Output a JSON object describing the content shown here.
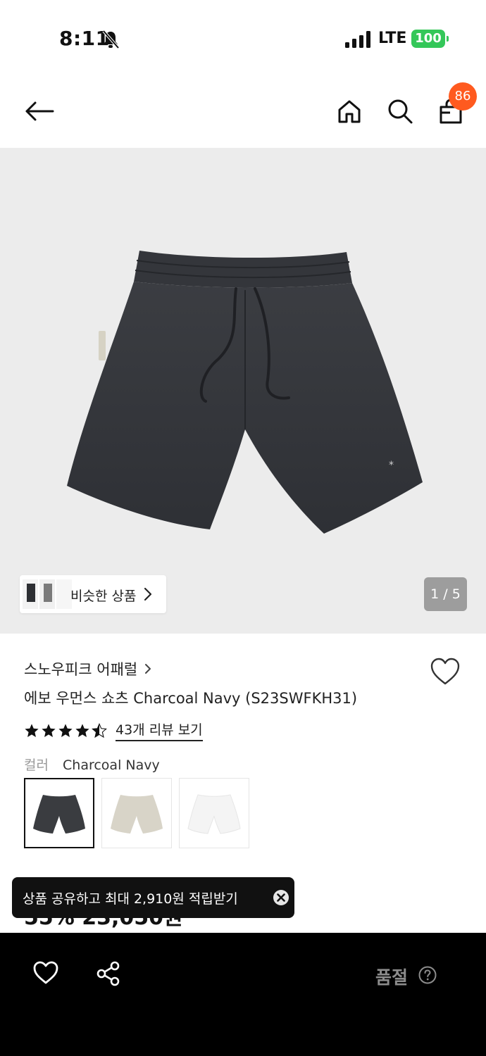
{
  "status_bar": {
    "time": "8:11",
    "network": "LTE",
    "battery": "100"
  },
  "header": {
    "cart_count": "86"
  },
  "gallery": {
    "similar_label": "비슷한 상품",
    "page_counter": "1 / 5"
  },
  "product": {
    "brand": "스노우피크 어패럴",
    "title": "에보 우먼스 쇼츠 Charcoal Navy (S23SWFKH31)",
    "rating": 4.5,
    "review_link": "43개 리뷰 보기",
    "color_label": "컬러",
    "color_value": "Charcoal Navy",
    "swatches": [
      {
        "color": "#3a3c40",
        "selected": true
      },
      {
        "color": "#d8d4c8",
        "selected": false
      },
      {
        "color": "#f4f4f4",
        "selected": false
      }
    ],
    "price_partial": "55% 23,050원"
  },
  "toast": {
    "text": "상품 공유하고 최대 2,910원 적립받기"
  },
  "bottom_bar": {
    "soldout_label": "품절"
  }
}
